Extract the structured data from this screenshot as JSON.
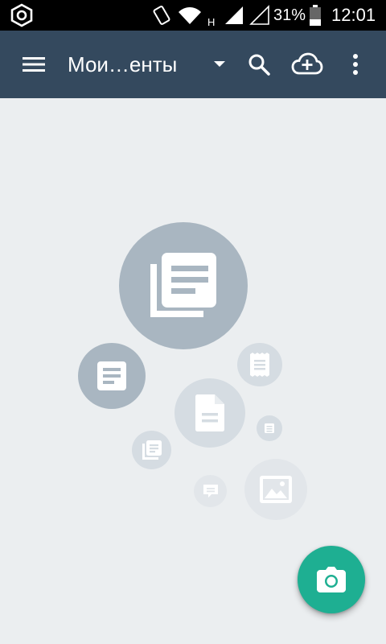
{
  "status_bar": {
    "network_type": "H",
    "battery_percent": "31%",
    "time": "12:01"
  },
  "app_bar": {
    "title": "Мои…енты",
    "menu_icon": "hamburger-menu-icon",
    "dropdown_icon": "dropdown-arrow-icon",
    "search_icon": "search-icon",
    "cloud_icon": "cloud-add-icon",
    "more_icon": "more-vert-icon"
  },
  "empty_state": {
    "icons": [
      "documents-icon",
      "document-icon",
      "file-icon",
      "receipt-icon",
      "small-doc-icon",
      "docs-small-icon",
      "chat-icon",
      "image-icon"
    ]
  },
  "fab": {
    "icon": "camera-icon"
  },
  "colors": {
    "app_bar": "#34495e",
    "background": "#ebeef0",
    "fab": "#1eaf92",
    "bubble_dark": "#a9b6c1",
    "bubble_mid": "#d5dce2",
    "bubble_light": "#e2e6ea"
  }
}
